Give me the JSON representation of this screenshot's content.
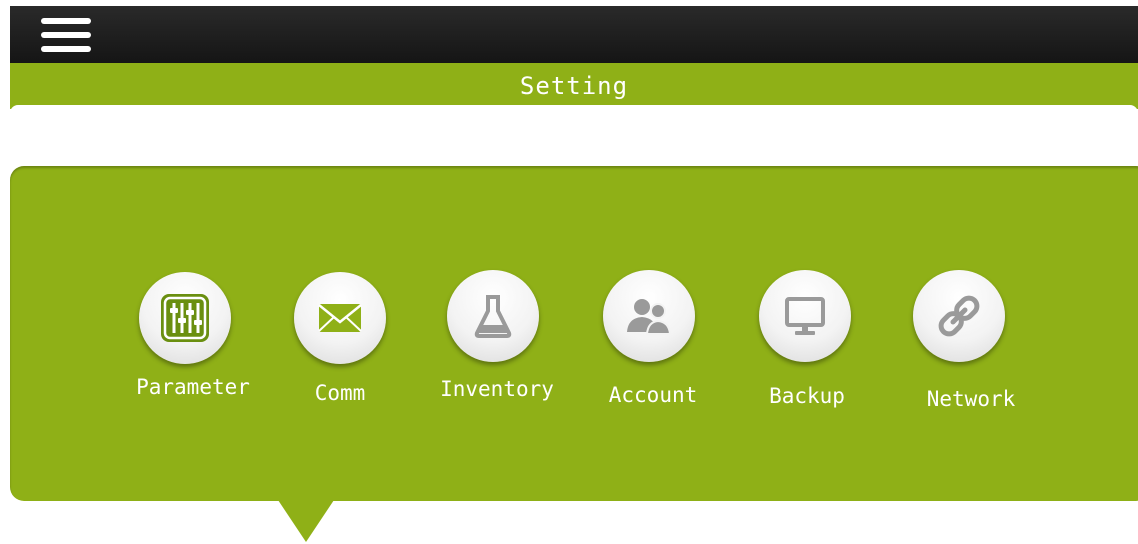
{
  "header": {
    "menu_icon": "hamburger-menu-icon",
    "title": "Setting"
  },
  "settings": {
    "items": [
      {
        "label": "Parameter",
        "icon": "sliders-icon"
      },
      {
        "label": "Comm",
        "icon": "envelope-icon"
      },
      {
        "label": "Inventory",
        "icon": "flask-icon"
      },
      {
        "label": "Account",
        "icon": "users-icon"
      },
      {
        "label": "Backup",
        "icon": "monitor-icon"
      },
      {
        "label": "Network",
        "icon": "link-icon"
      }
    ]
  },
  "colors": {
    "accent": "#8fb017",
    "topbar": "#1c1c1c",
    "icon_active": "#6a8f10",
    "icon_inactive": "#9a9a9a"
  }
}
